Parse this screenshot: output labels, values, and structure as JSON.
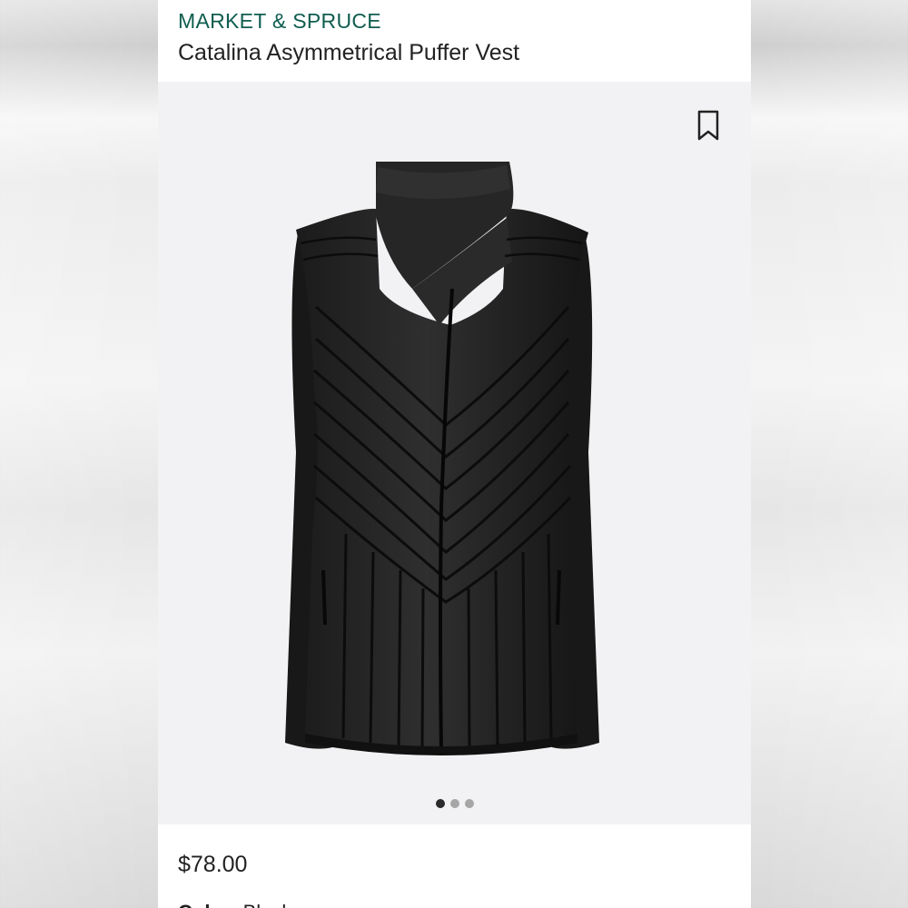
{
  "product": {
    "brand": "MARKET & SPRUCE",
    "title": "Catalina Asymmetrical Puffer Vest",
    "price": "$78.00",
    "color_label": "Color",
    "color_value": "Black",
    "image_alt": "Black asymmetrical puffer vest",
    "gallery": {
      "image_count": 3,
      "active_index": 0
    }
  },
  "icons": {
    "save": "bookmark-icon"
  },
  "colors": {
    "brand_green": "#0f5d4f",
    "text_dark": "#222222",
    "gallery_bg": "#f2f2f4",
    "dot_active": "#2b2b2b",
    "dot_inactive": "#a6a6a6"
  }
}
